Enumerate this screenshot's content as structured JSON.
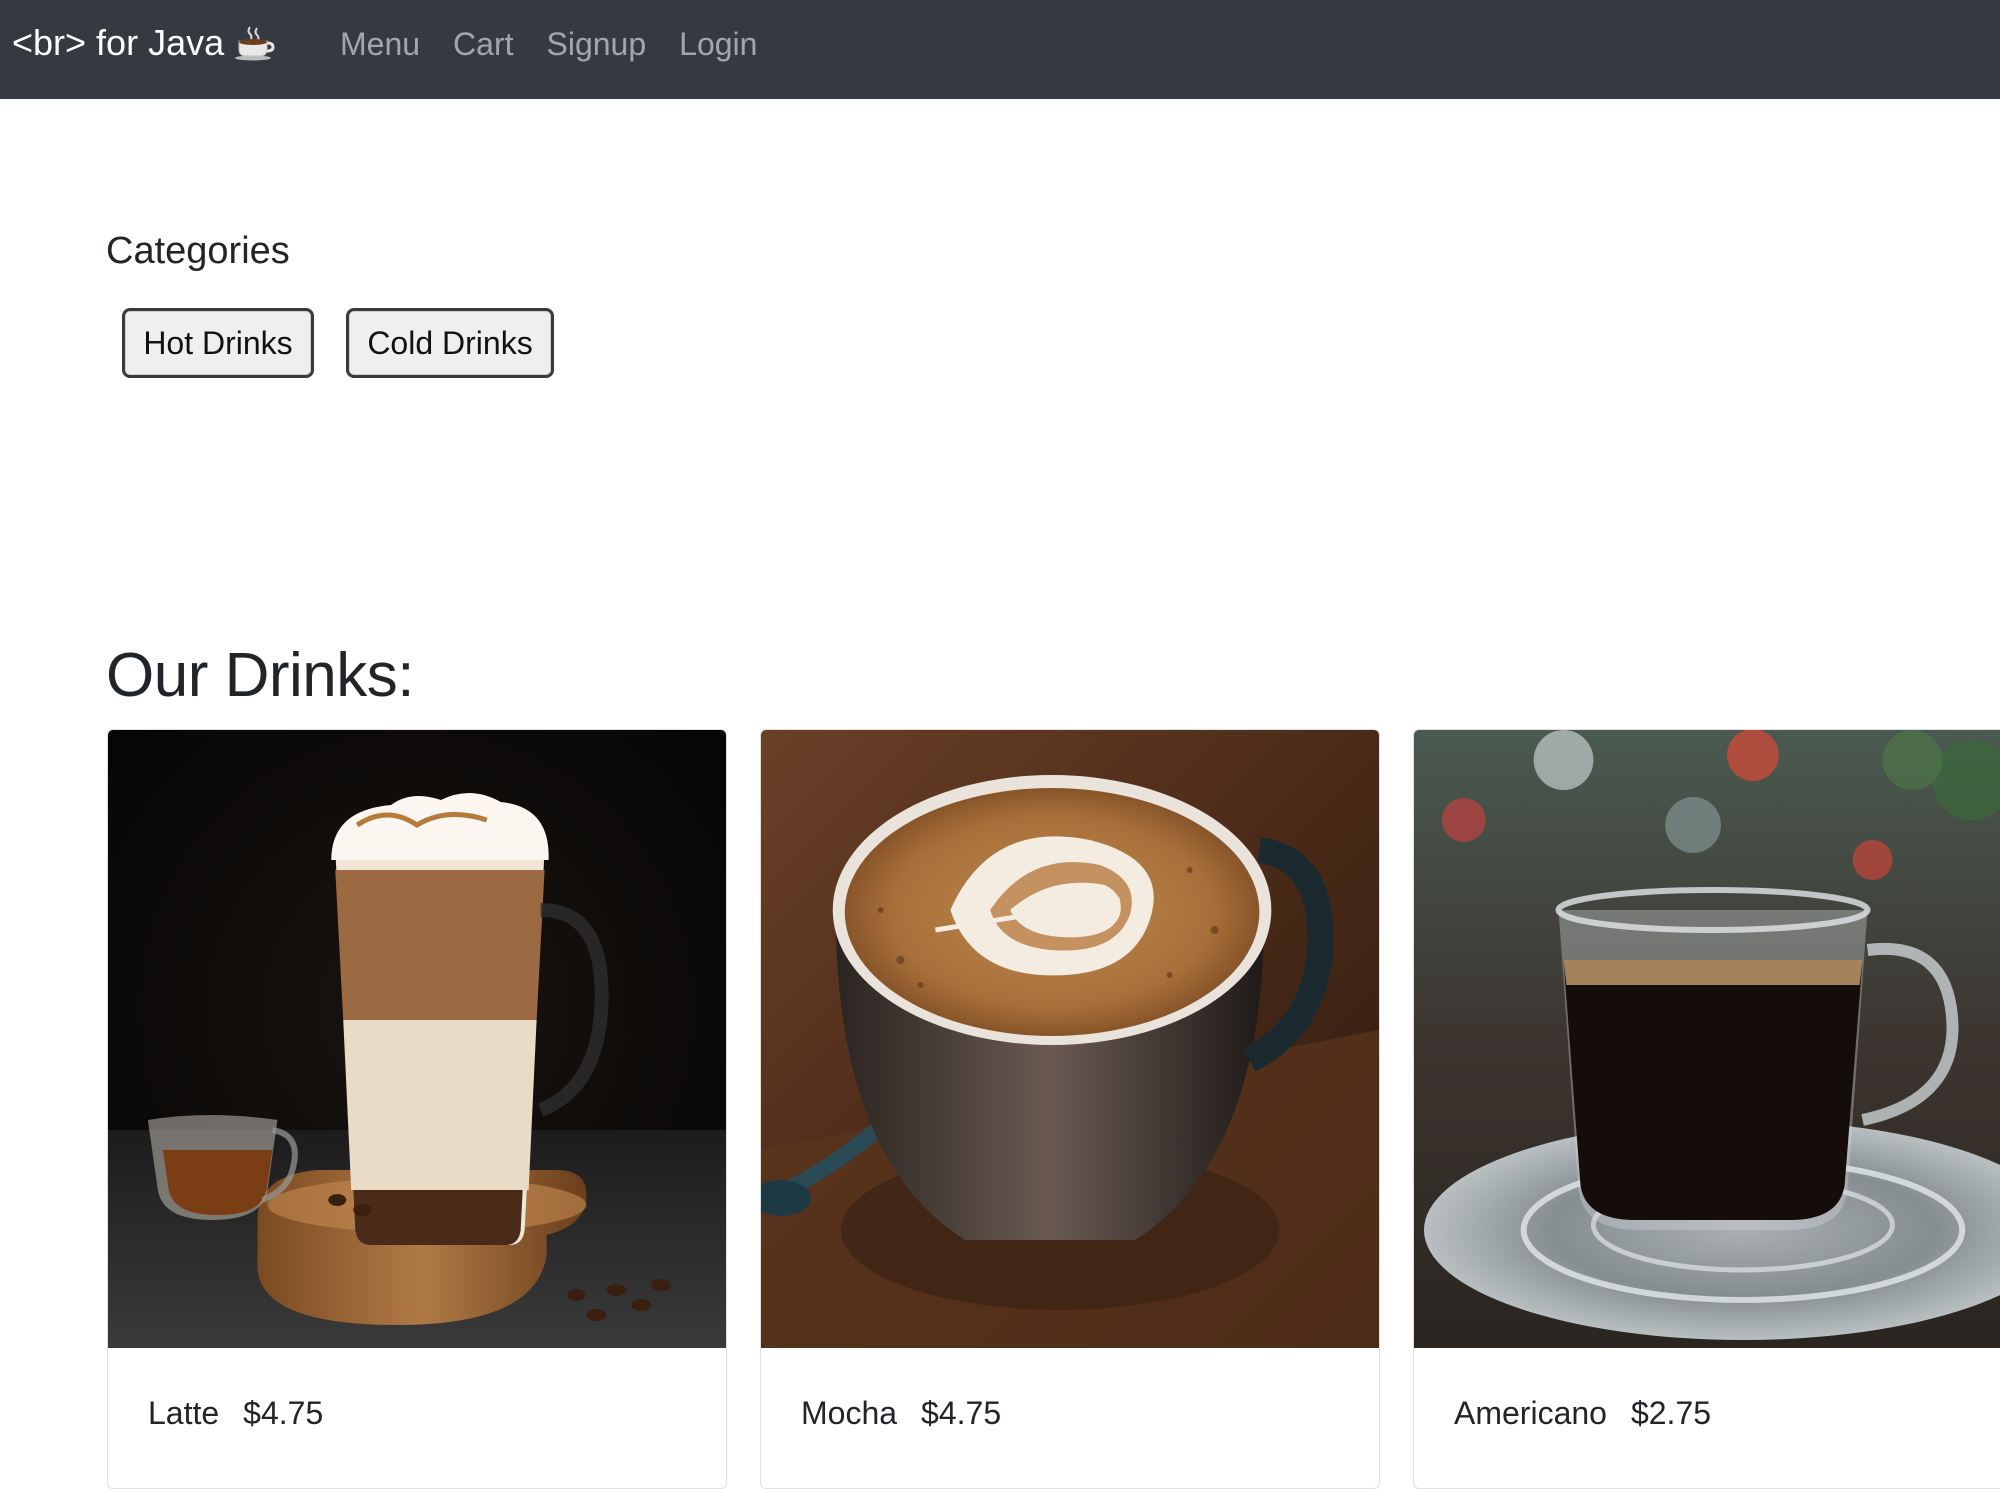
{
  "navbar": {
    "brand": "<br> for Java",
    "brand_icon": "coffee-cup-icon",
    "links": [
      "Menu",
      "Cart",
      "Signup",
      "Login"
    ],
    "bg_color": "#343a40"
  },
  "categories": {
    "title": "Categories",
    "buttons": [
      "Hot Drinks",
      "Cold Drinks"
    ]
  },
  "drinks": {
    "title": "Our Drinks:",
    "items": [
      {
        "name": "Latte",
        "price": "$4.75",
        "image": "layered latte in tall glass with whipped cream and caramel"
      },
      {
        "name": "Mocha",
        "price": "$4.75",
        "image": "cup of coffee with latte art on wooden board"
      },
      {
        "name": "Americano",
        "price": "$2.75",
        "image": "black coffee in glass cup on saucer"
      }
    ]
  }
}
